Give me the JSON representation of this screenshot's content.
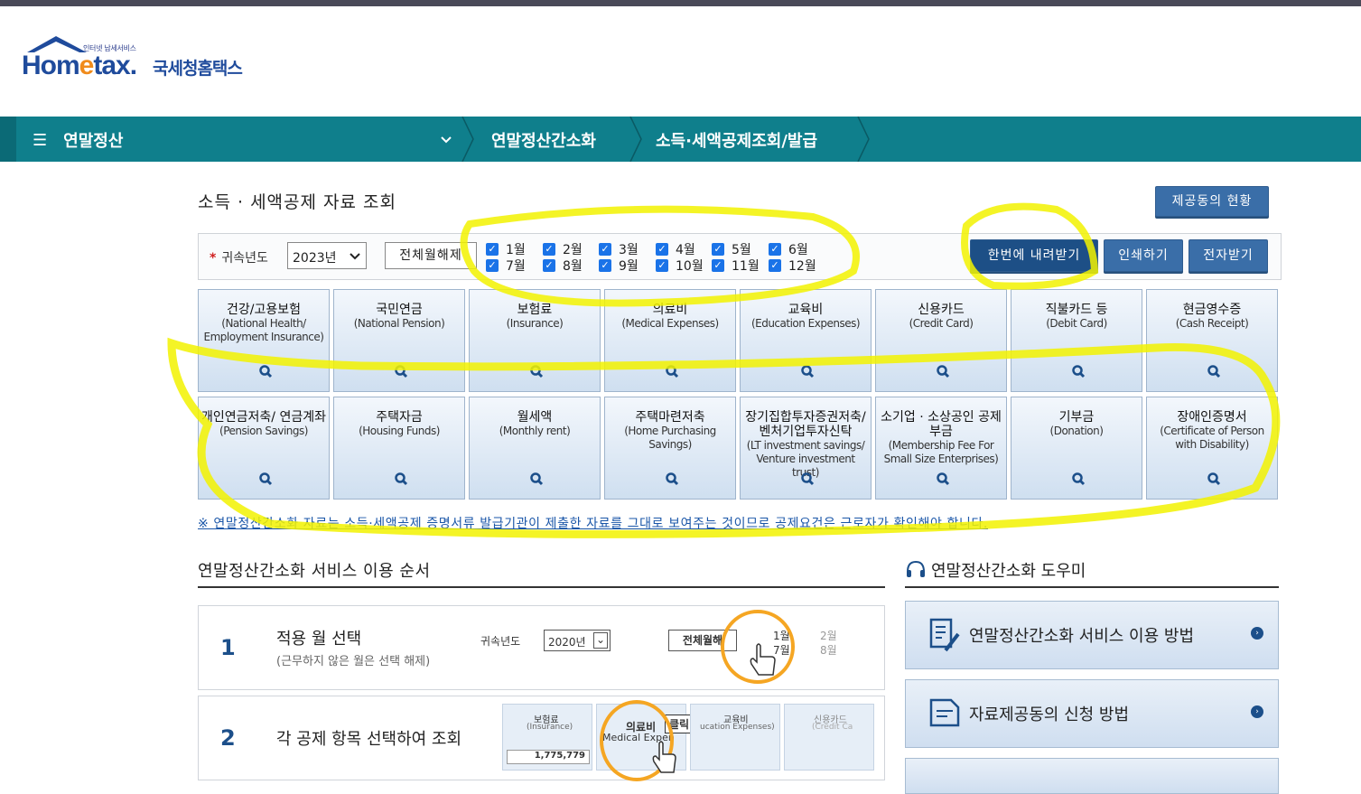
{
  "logo": {
    "small": "인터넷 납세서비스",
    "brand_a": "Hom",
    "brand_e": "e",
    "brand_b": "tax.",
    "korean": "국세청홈택스"
  },
  "nav": {
    "menu": "연말정산",
    "crumbs": [
      "연말정산간소화",
      "소득·세액공제조회/발급"
    ]
  },
  "page": {
    "title": "소득 · 세액공제 자료 조회",
    "consent_button": "제공동의 현황",
    "year_label": "귀속년도",
    "year_value": "2023년",
    "clear_button": "전체월해제",
    "months": [
      "1월",
      "2월",
      "3월",
      "4월",
      "5월",
      "6월",
      "7월",
      "8월",
      "9월",
      "10월",
      "11월",
      "12월"
    ],
    "download_button": "한번에 내려받기",
    "print_button": "인쇄하기",
    "e_receive_button": "전자받기",
    "note": "※ 연말정산간소화 자료는 소득·세액공제 증명서류 발급기관이 제출한 자료를 그대로 보여주는 것이므로 공제요건은 근로자가 확인해야 합니다."
  },
  "tiles": [
    {
      "ko": "건강/고용보험",
      "en": "(National Health/ Employment Insurance)"
    },
    {
      "ko": "국민연금",
      "en": "(National Pension)"
    },
    {
      "ko": "보험료",
      "en": "(Insurance)"
    },
    {
      "ko": "의료비",
      "en": "(Medical Expenses)"
    },
    {
      "ko": "교육비",
      "en": "(Education Expenses)"
    },
    {
      "ko": "신용카드",
      "en": "(Credit Card)"
    },
    {
      "ko": "직불카드 등",
      "en": "(Debit Card)"
    },
    {
      "ko": "현금영수증",
      "en": "(Cash Receipt)"
    },
    {
      "ko": "개인연금저축/ 연금계좌",
      "en": "(Pension Savings)"
    },
    {
      "ko": "주택자금",
      "en": "(Housing Funds)"
    },
    {
      "ko": "월세액",
      "en": "(Monthly rent)"
    },
    {
      "ko": "주택마련저축",
      "en": "(Home Purchasing Savings)"
    },
    {
      "ko": "장기집합투자증권저축/ 벤처기업투자신탁",
      "en": "(LT investment savings/ Venture investment trust)"
    },
    {
      "ko": "소기업 · 소상공인 공제부금",
      "en": "(Membership Fee For Small Size Enterprises)"
    },
    {
      "ko": "기부금",
      "en": "(Donation)"
    },
    {
      "ko": "장애인증명서",
      "en": "(Certificate of Person with Disability)"
    }
  ],
  "steps": {
    "title": "연말정산간소화 서비스 이용 순서",
    "items": [
      {
        "num": "1",
        "title": "적용 월 선택",
        "sub": "(근무하지 않은 월은 선택 해제)"
      },
      {
        "num": "2",
        "title": "각 공제 항목 선택하여 조회",
        "sub": ""
      }
    ],
    "mini1": {
      "year_label": "귀속년도",
      "year": "2020년",
      "clear": "전체월해",
      "m1": "1월",
      "m2": "2월",
      "m7": "7월",
      "m8": "8월"
    },
    "mini2": {
      "t1": "보험료",
      "t1en": "(Insurance)",
      "t1val": "1,775,779",
      "t2": "의료비",
      "t2en": "Medical Expen",
      "click": "클릭!",
      "t3": "교육비",
      "t3en": "ucation Expenses)",
      "t4": "신용카드",
      "t4en": "(Credit Ca"
    }
  },
  "helper": {
    "title": "연말정산간소화 도우미",
    "items": [
      "연말정산간소화 서비스 이용 방법",
      "자료제공동의 신청 방법"
    ]
  },
  "colors": {
    "nav": "#0f7f8c",
    "highlight": "#f2f200",
    "button": "#3a6ea8"
  }
}
